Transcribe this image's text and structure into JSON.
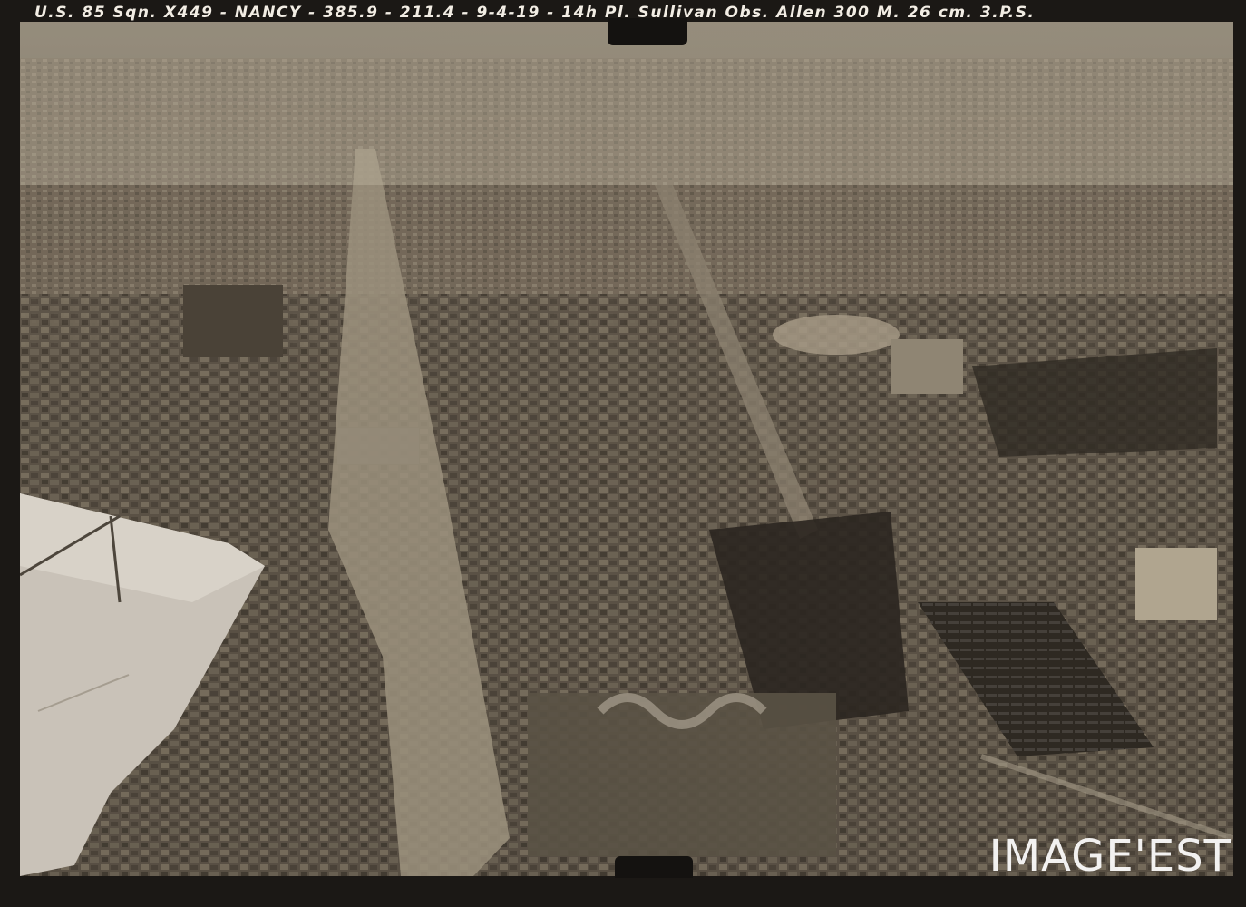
{
  "caption": "U.S. 85 Sqn. X449 - NANCY - 385.9 - 211.4 - 9-4-19 - 14h Pl. Sullivan Obs. Allen 300 M. 26 cm. 3.P.S.",
  "watermark": "IMAGE'EST",
  "colors": {
    "print_border": "#1b1815",
    "sepia_light": "#b8ad9b",
    "sepia_dark": "#3c352c",
    "wing": "#c9c2b8"
  }
}
